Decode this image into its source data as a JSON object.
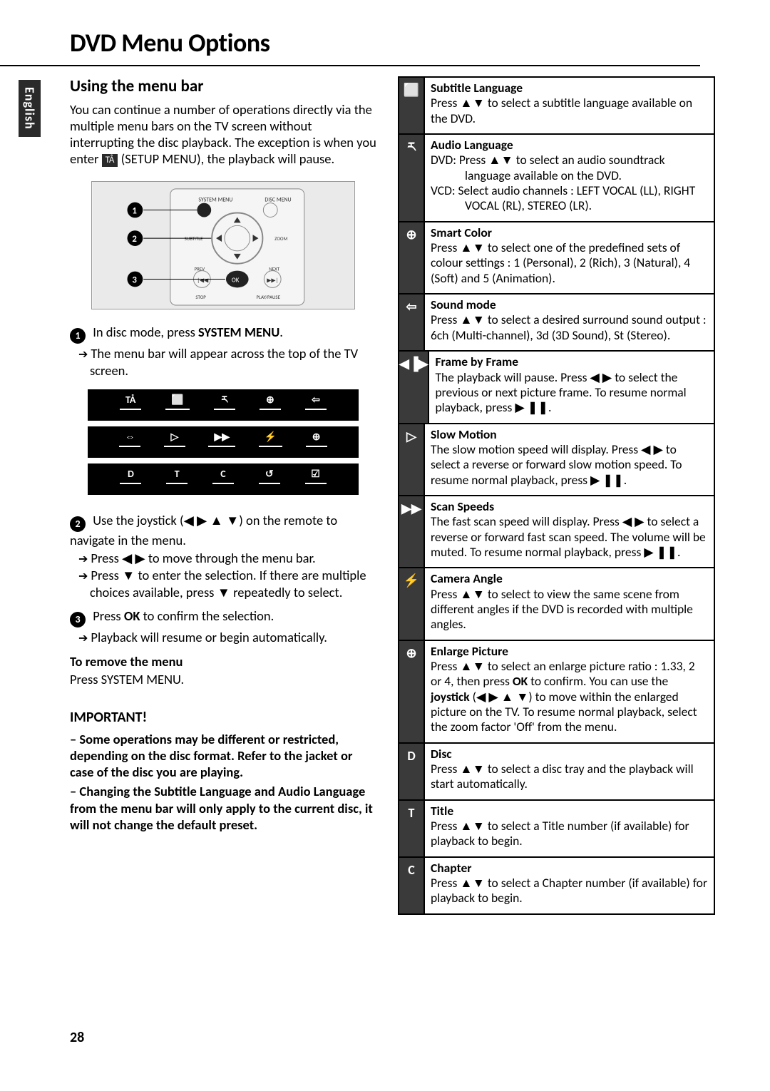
{
  "page": {
    "title": "DVD Menu Options",
    "language_tab": "English",
    "page_number": "28"
  },
  "left": {
    "heading": "Using the menu bar",
    "intro_pre": "You can continue a number of operations directly via the multiple menu bars on the TV screen without interrupting the disc playback. The exception is when you enter ",
    "intro_icon": "TÅ",
    "intro_post": " (SETUP MENU), the playback will pause.",
    "step1_pre": "In disc mode, press ",
    "step1_strong": "SYSTEM MENU",
    "step1_post": ".",
    "step1_sub": "The menu bar will appear across the top of the TV screen.",
    "step2": "Use the joystick (◀ ▶ ▲ ▼) on the remote to navigate in the menu.",
    "step2_sub1": "Press ◀ ▶ to move through the menu bar.",
    "step2_sub2": "Press ▼ to enter the selection.  If there are multiple choices available, press ▼ repeatedly to select.",
    "step3_pre": "Press ",
    "step3_strong": "OK",
    "step3_post": " to confirm the selection.",
    "step3_sub": "Playback will resume or begin automatically.",
    "remove_heading": "To remove the menu",
    "remove_body": "Press SYSTEM MENU.",
    "important_title": "IMPORTANT!",
    "important_p1": "–  Some operations may be different or restricted, depending on the disc format. Refer to the jacket or case of the disc you are playing.",
    "important_p2": "–  Changing the Subtitle Language and Audio Language from the menu bar will only apply to the current disc, it will not change the default preset.",
    "menubar_rows": [
      [
        "TÅ",
        "⬜",
        "ཪ",
        "⊕",
        "⇦"
      ],
      [
        "⇔",
        "▷",
        "▶▶",
        "⚡",
        "⊕"
      ],
      [
        "D",
        "T",
        "C",
        "↺",
        "☑"
      ]
    ]
  },
  "features": [
    {
      "icon": "⬜",
      "icon_name": "subtitle-icon",
      "title": "Subtitle Language",
      "body_plain": "Press ▲▼ to select a subtitle language available on the DVD."
    },
    {
      "icon": "ཪ",
      "icon_name": "audio-icon",
      "title": "Audio Language",
      "lines": [
        {
          "label": "DVD:",
          "text": "Press ▲▼ to select an audio soundtrack language available on the DVD."
        },
        {
          "label": "VCD:",
          "text": "Select audio channels : LEFT VOCAL (LL), RIGHT VOCAL (RL), STEREO (LR)."
        }
      ]
    },
    {
      "icon": "⊕",
      "icon_name": "smart-color-icon",
      "title": "Smart Color",
      "body_plain": "Press ▲▼ to select one of the predefined sets of colour settings : 1 (Personal), 2 (Rich), 3 (Natural), 4 (Soft) and 5 (Animation)."
    },
    {
      "icon": "⇦",
      "icon_name": "sound-mode-icon",
      "title": "Sound mode",
      "body_plain": "Press ▲▼ to select a desired surround sound output : 6ch (Multi-channel), 3d (3D Sound), St (Stereo)."
    },
    {
      "icon": "◀▐▶",
      "icon_name": "frame-by-frame-icon",
      "title": "Frame by Frame",
      "body_plain": "The playback will pause.  Press ◀ ▶ to select the previous or next picture frame. To resume normal playback, press  ▶ ❚❚."
    },
    {
      "icon": "▷",
      "icon_name": "slow-motion-icon",
      "title": "Slow Motion",
      "body_plain": "The slow motion speed will display. Press ◀ ▶ to select a reverse or forward slow motion speed. To resume normal playback, press  ▶ ❚❚."
    },
    {
      "icon": "▶▶",
      "icon_name": "scan-speeds-icon",
      "title": "Scan Speeds",
      "body_plain": "The fast scan speed will display.  Press ◀ ▶ to select a reverse or forward fast scan speed. The volume will be muted.  To resume normal playback, press  ▶ ❚❚."
    },
    {
      "icon": "⚡",
      "icon_name": "camera-angle-icon",
      "title": "Camera Angle",
      "body_plain": "Press ▲▼ to select to view the same scene from different angles if the DVD is recorded with multiple angles."
    },
    {
      "icon": "⊕",
      "icon_name": "enlarge-picture-icon",
      "title": "Enlarge Picture",
      "body_pre": "Press ▲▼ to select an enlarge picture ratio : 1.33, 2 or 4, then press ",
      "body_strong1": "OK",
      "body_mid": " to confirm. You can use the ",
      "body_strong2": "joystick",
      "body_post": " (◀ ▶ ▲ ▼) to move within the enlarged picture on the TV. To resume normal playback, select the zoom factor 'Off' from the menu."
    },
    {
      "icon": "D",
      "icon_name": "disc-icon",
      "title": "Disc",
      "body_plain": "Press ▲▼ to select a disc tray and the playback will start automatically."
    },
    {
      "icon": "T",
      "icon_name": "title-icon",
      "title": "Title",
      "body_plain": "Press ▲▼ to select a Title number (if available) for playback to begin."
    },
    {
      "icon": "C",
      "icon_name": "chapter-icon",
      "title": "Chapter",
      "body_plain": "Press ▲▼ to select a Chapter number (if available) for playback to begin."
    }
  ]
}
